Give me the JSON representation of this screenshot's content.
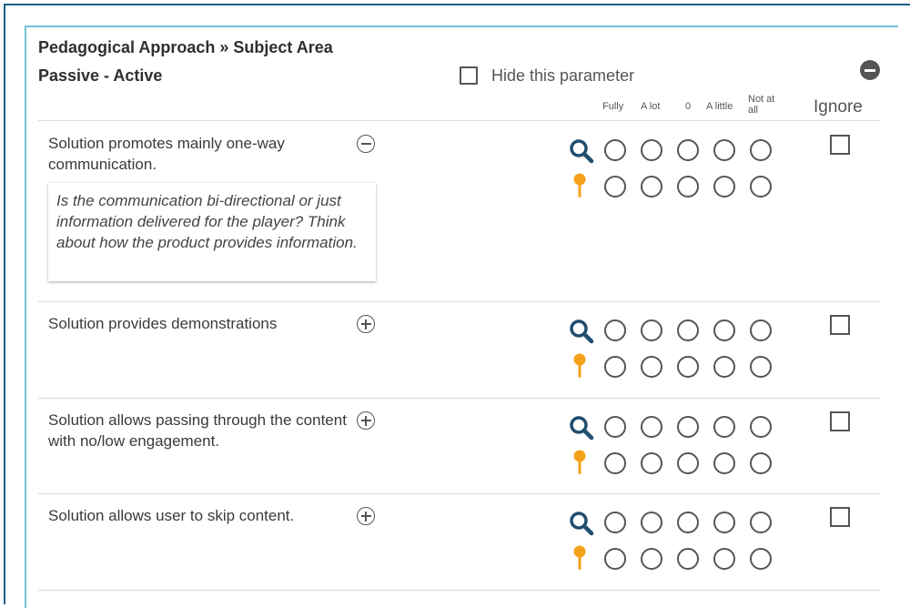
{
  "header": {
    "breadcrumb": "Pedagogical Approach » Subject Area",
    "subtitle": "Passive - Active",
    "hide_label": "Hide this parameter"
  },
  "columns": {
    "fully": "Fully",
    "a_lot": "A lot",
    "zero": "0",
    "a_little": "A little",
    "not_at_all_1": "Not at",
    "not_at_all_2": "all",
    "ignore": "Ignore"
  },
  "rows": [
    {
      "text": "Solution promotes mainly one-way communication.",
      "expanded": true,
      "hint": "Is the communication bi-directional or just information delivered for the player? Think about how the product provides information."
    },
    {
      "text": "Solution provides demonstrations",
      "expanded": false
    },
    {
      "text": "Solution allows passing through the content with no/low engagement.",
      "expanded": false
    },
    {
      "text": "Solution allows user to skip content.",
      "expanded": false
    }
  ],
  "colors": {
    "border_outer": "#1f5f86",
    "border_panel": "#6fc3d6",
    "search_icon": "#1f4e6e",
    "pin_icon": "#f5a21b"
  }
}
